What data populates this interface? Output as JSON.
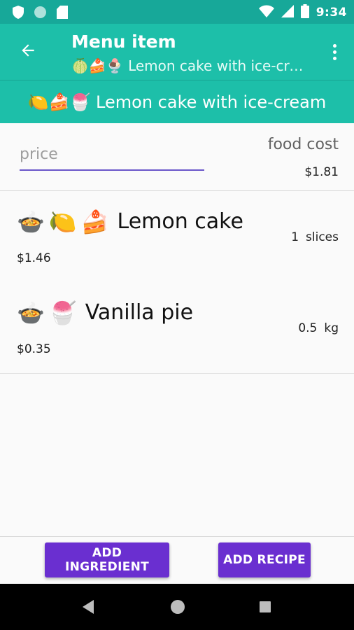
{
  "status_bar": {
    "time": "9:34",
    "icons": [
      "shield-icon",
      "circle-icon",
      "sd-card-icon",
      "wifi-icon",
      "signal-icon",
      "battery-icon"
    ]
  },
  "app_bar": {
    "title": "Menu item",
    "subtitle": "🍈🍰🍨 Lemon cake with ice-cream"
  },
  "banner": {
    "text": "🍋🍰🍧 Lemon cake with ice-cream"
  },
  "price": {
    "placeholder": "price",
    "value": "",
    "food_cost_label": "food cost",
    "food_cost_value": "$1.81"
  },
  "ingredients": [
    {
      "emojis": [
        "🍲",
        "🍋",
        "🍰"
      ],
      "name": "Lemon cake",
      "cost": "$1.46",
      "quantity": "1",
      "unit": "slices"
    },
    {
      "emojis": [
        "🍲",
        "🍧"
      ],
      "name": "Vanilla pie",
      "cost": "$0.35",
      "quantity": "0.5",
      "unit": "kg"
    }
  ],
  "buttons": {
    "add_ingredient": "ADD INGREDIENT",
    "add_recipe": "ADD RECIPE"
  },
  "colors": {
    "status_bar": "#17a899",
    "app_bar": "#1dbfa9",
    "accent": "#6a2fd0",
    "input_underline": "#6a56c9"
  }
}
